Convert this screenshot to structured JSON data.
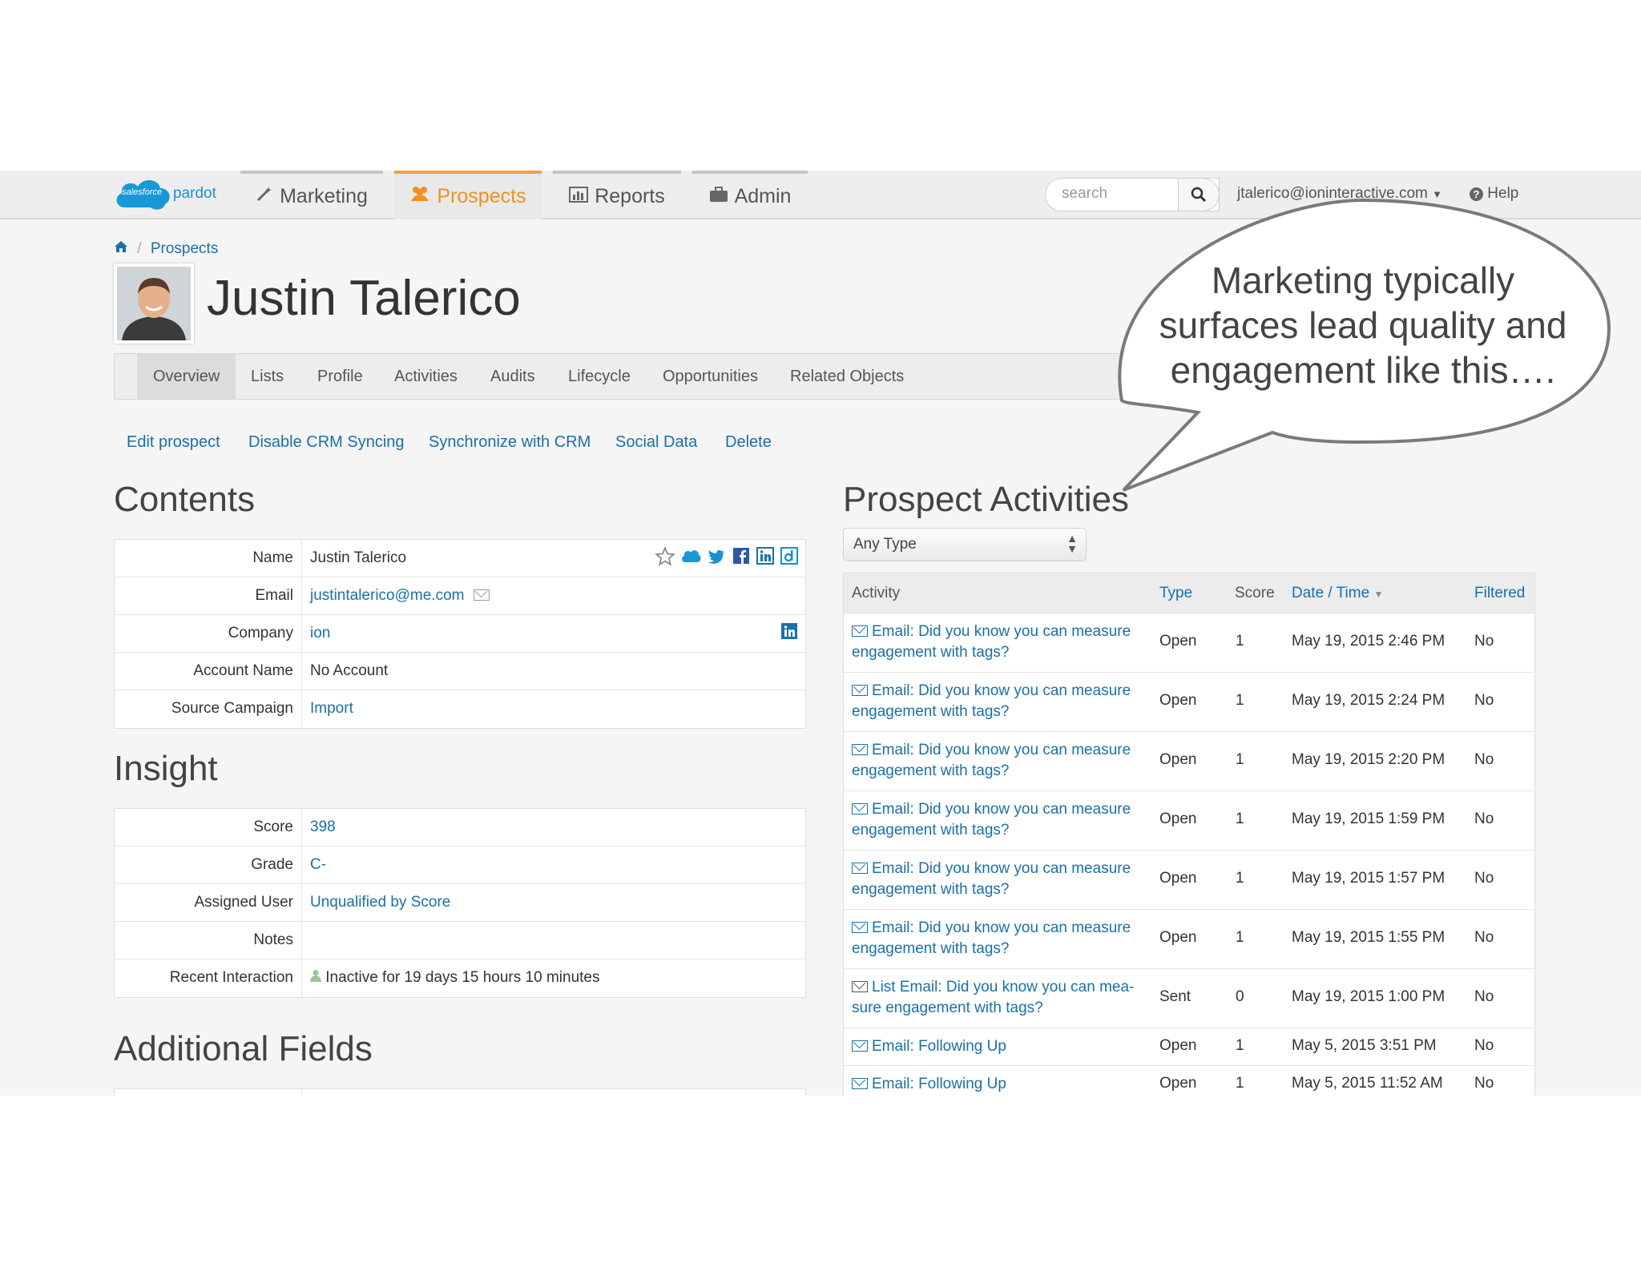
{
  "brand": {
    "cloud_text": "salesforce",
    "name": "pardot"
  },
  "nav": {
    "tabs": [
      {
        "label": "Marketing"
      },
      {
        "label": "Prospects"
      },
      {
        "label": "Reports"
      },
      {
        "label": "Admin"
      }
    ],
    "search_placeholder": "search",
    "user": "jtalerico@ioninteractive.com",
    "help": "Help"
  },
  "breadcrumb": {
    "current": "Prospects"
  },
  "prospect": {
    "name": "Justin Talerico"
  },
  "subtabs": [
    "Overview",
    "Lists",
    "Profile",
    "Activities",
    "Audits",
    "Lifecycle",
    "Opportunities",
    "Related Objects"
  ],
  "actions": [
    "Edit prospect",
    "Disable CRM Syncing",
    "Synchronize with CRM",
    "Social Data",
    "Delete"
  ],
  "contents": {
    "title": "Contents",
    "rows": [
      {
        "label": "Name",
        "value": "Justin Talerico"
      },
      {
        "label": "Email",
        "value": "justintalerico@me.com"
      },
      {
        "label": "Company",
        "value": "ion"
      },
      {
        "label": "Account Name",
        "value": "No Account"
      },
      {
        "label": "Source Campaign",
        "value": "Import"
      }
    ]
  },
  "insight": {
    "title": "Insight",
    "rows": [
      {
        "label": "Score",
        "value": "398"
      },
      {
        "label": "Grade",
        "value": "C-"
      },
      {
        "label": "Assigned User",
        "value": "Unqualified by Score"
      },
      {
        "label": "Notes",
        "value": ""
      },
      {
        "label": "Recent Interaction",
        "value": "Inactive for 19 days 15 hours 10 minutes"
      }
    ]
  },
  "additional": {
    "title": "Additional Fields"
  },
  "activities": {
    "title": "Prospect Activities",
    "filter": "Any Type",
    "columns": [
      "Activity",
      "Type",
      "Score",
      "Date / Time",
      "Filtered"
    ],
    "rows": [
      {
        "activity_l1": "Email: Did you know you can measure",
        "activity_l2": "engagement with tags?",
        "type": "Open",
        "score": "1",
        "date": "May 19, 2015 2:46 PM",
        "filtered": "No"
      },
      {
        "activity_l1": "Email: Did you know you can measure",
        "activity_l2": "engagement with tags?",
        "type": "Open",
        "score": "1",
        "date": "May 19, 2015 2:24 PM",
        "filtered": "No"
      },
      {
        "activity_l1": "Email: Did you know you can measure",
        "activity_l2": "engagement with tags?",
        "type": "Open",
        "score": "1",
        "date": "May 19, 2015 2:20 PM",
        "filtered": "No"
      },
      {
        "activity_l1": "Email: Did you know you can measure",
        "activity_l2": "engagement with tags?",
        "type": "Open",
        "score": "1",
        "date": "May 19, 2015 1:59 PM",
        "filtered": "No"
      },
      {
        "activity_l1": "Email: Did you know you can measure",
        "activity_l2": "engagement with tags?",
        "type": "Open",
        "score": "1",
        "date": "May 19, 2015 1:57 PM",
        "filtered": "No"
      },
      {
        "activity_l1": "Email: Did you know you can measure",
        "activity_l2": "engagement with tags?",
        "type": "Open",
        "score": "1",
        "date": "May 19, 2015 1:55 PM",
        "filtered": "No"
      },
      {
        "activity_l1": "List Email: Did you know you can mea-",
        "activity_l2": "sure engagement with tags?",
        "type": "Sent",
        "score": "0",
        "date": "May 19, 2015 1:00 PM",
        "filtered": "No"
      },
      {
        "activity_l1": "Email: Following Up",
        "activity_l2": "",
        "type": "Open",
        "score": "1",
        "date": "May 5, 2015 3:51 PM",
        "filtered": "No"
      },
      {
        "activity_l1": "Email: Following Up",
        "activity_l2": "",
        "type": "Open",
        "score": "1",
        "date": "May 5, 2015 11:52 AM",
        "filtered": "No"
      }
    ]
  },
  "callout": {
    "lines": [
      "Marketing typically",
      "surfaces lead quality and",
      "engagement like this…."
    ]
  },
  "colors": {
    "link": "#1a6fad",
    "accent": "#f38f1d",
    "brand_blue": "#1a8fd6"
  },
  "icons": [
    "wand-icon",
    "users-icon",
    "bar-chart-icon",
    "briefcase-icon",
    "search-icon",
    "help-icon",
    "home-icon",
    "star-icon",
    "salesforce-icon",
    "twitter-icon",
    "facebook-icon",
    "linkedin-icon",
    "data-icon",
    "mail-icon",
    "user-icon"
  ]
}
